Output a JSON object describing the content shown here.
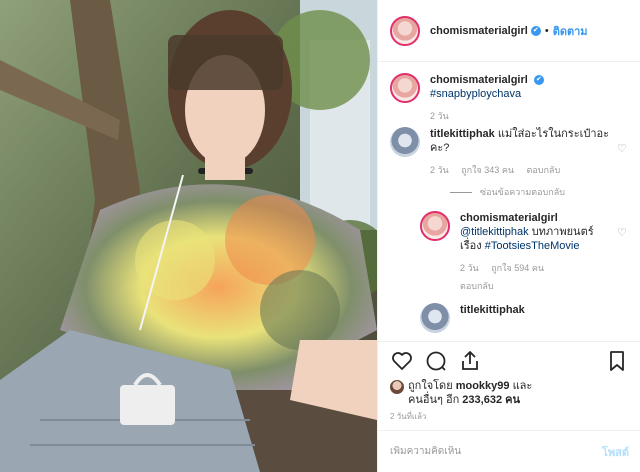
{
  "header": {
    "username": "chomismaterialgirl",
    "verified_mark": "✔",
    "separator": "•",
    "follow_label": "ติดตาม"
  },
  "comments": [
    {
      "username": "chomismaterialgirl",
      "verified_mark": "✔",
      "text": "#snapbyploychava",
      "time": "2 วัน"
    },
    {
      "username": "titlekittiphak",
      "text": "แม่ใส่อะไรในกระเป๋าอะคะ?",
      "time": "2 วัน",
      "likes": "ถูกใจ 343 คน",
      "reply_label": "ตอบกลับ",
      "hide_replies_label": "ซ่อนข้อความตอบกลับ"
    }
  ],
  "replies": [
    {
      "username": "chomismaterialgirl",
      "mention": "@titlekittiphak",
      "text": " บทภาพยนตร์เรื่อง ",
      "hashtag": "#TootsiesTheMovie",
      "time": "2 วัน",
      "likes": "ถูกใจ 594 คน",
      "reply_label": "ตอบกลับ"
    },
    {
      "username": "titlekittiphak"
    }
  ],
  "likes_line": {
    "prefix": "ถูกใจโดย ",
    "user": "mookky99",
    "middle": " และ",
    "others_prefix": "คนอื่นๆ อีก ",
    "others_count": "233,632 คน"
  },
  "post_age": "2 วันที่แล้ว",
  "add_comment": {
    "placeholder": "เพิ่มความคิดเห็น",
    "post_label": "โพสต์"
  },
  "icons": [
    "heart-icon",
    "comment-icon",
    "share-icon",
    "bookmark-icon"
  ],
  "colors": {
    "link_blue": "#3897f0",
    "hashtag_blue": "#003569",
    "muted": "#999999",
    "post_disabled": "#b2dffc",
    "story_ring": "#e1306c"
  }
}
